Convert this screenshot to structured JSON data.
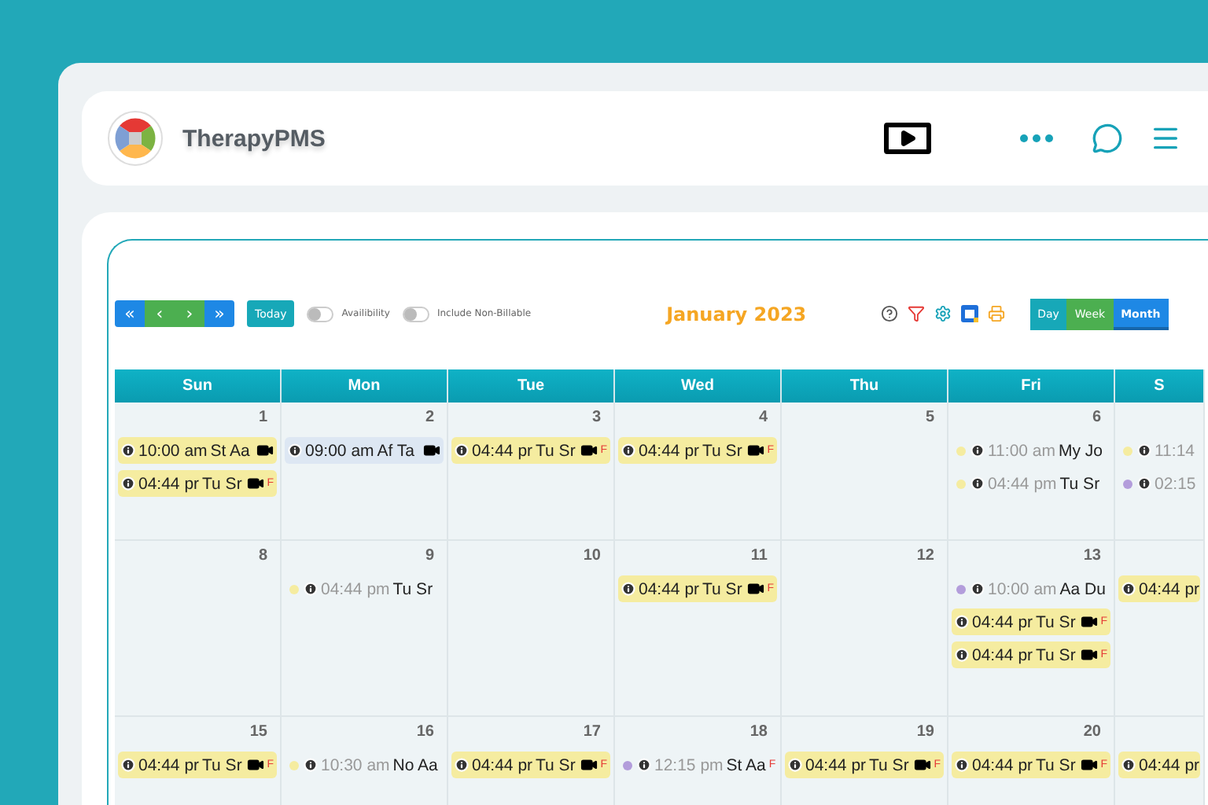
{
  "app": {
    "name": "TherapyPMS"
  },
  "toolbar": {
    "nav": [
      {
        "label": "«",
        "color": "#1e88e5"
      },
      {
        "label": "‹",
        "color": "#4caf50"
      },
      {
        "label": "›",
        "color": "#4caf50"
      },
      {
        "label": "»",
        "color": "#1e88e5"
      }
    ],
    "today": "Today",
    "toggles": [
      {
        "label": "Availibility",
        "on": false
      },
      {
        "label": "Include Non-Billable",
        "on": false
      }
    ],
    "title": "January 2023",
    "views": [
      {
        "label": "Day",
        "color": "#17a8b8",
        "selected": false
      },
      {
        "label": "Week",
        "color": "#4caf50",
        "selected": false
      },
      {
        "label": "Month",
        "color": "#1e88e5",
        "selected": true
      }
    ]
  },
  "calendar": {
    "days": [
      "Sun",
      "Mon",
      "Tue",
      "Wed",
      "Thu",
      "Fri",
      "S"
    ],
    "weeks": [
      [
        {
          "date": "1",
          "events": [
            {
              "kind": "block",
              "time": "10:00 am",
              "name": "St Aa",
              "color": "#f5eca0"
            },
            {
              "kind": "block",
              "time": "04:44 pr",
              "name": "Tu Sr",
              "color": "#f5eca0",
              "tag": "F"
            }
          ]
        },
        {
          "date": "2",
          "events": [
            {
              "kind": "block",
              "time": "09:00 am",
              "name": "Af Ta",
              "color": "#dde7f3"
            }
          ]
        },
        {
          "date": "3",
          "events": [
            {
              "kind": "block",
              "time": "04:44 pr",
              "name": "Tu Sr",
              "color": "#f5eca0",
              "tag": "F"
            }
          ]
        },
        {
          "date": "4",
          "events": [
            {
              "kind": "block",
              "time": "04:44 pr",
              "name": "Tu Sr",
              "color": "#f5eca0",
              "tag": "F"
            }
          ]
        },
        {
          "date": "5"
        },
        {
          "date": "6",
          "events": [
            {
              "kind": "dot",
              "time": "11:00 am",
              "name": "My Jo",
              "color": "#f5eca0"
            },
            {
              "kind": "dot",
              "time": "04:44 pm",
              "name": "Tu Sr",
              "color": "#f5eca0"
            }
          ]
        },
        {
          "events": [
            {
              "kind": "dot",
              "time": "11:14",
              "color": "#f5eca0"
            },
            {
              "kind": "dot",
              "time": "02:15",
              "color": "#b39ddb"
            }
          ]
        }
      ],
      [
        {
          "date": "8"
        },
        {
          "date": "9",
          "events": [
            {
              "kind": "dot",
              "time": "04:44 pm",
              "name": "Tu Sr",
              "color": "#f5eca0"
            }
          ]
        },
        {
          "date": "10"
        },
        {
          "date": "11",
          "events": [
            {
              "kind": "block",
              "time": "04:44 pr",
              "name": "Tu Sr",
              "color": "#f5eca0",
              "tag": "F"
            }
          ]
        },
        {
          "date": "12"
        },
        {
          "date": "13",
          "events": [
            {
              "kind": "dot",
              "time": "10:00 am",
              "name": "Aa Du",
              "color": "#b39ddb"
            },
            {
              "kind": "block",
              "time": "04:44 pr",
              "name": "Tu Sr",
              "color": "#f5eca0",
              "tag": "F"
            },
            {
              "kind": "block",
              "time": "04:44 pr",
              "name": "Tu Sr",
              "color": "#f5eca0",
              "tag": "F"
            }
          ]
        },
        {
          "events": [
            {
              "kind": "block",
              "time": "04:44 pr",
              "color": "#f5eca0"
            }
          ]
        }
      ],
      [
        {
          "date": "15",
          "events": [
            {
              "kind": "block",
              "time": "04:44 pr",
              "name": "Tu Sr",
              "color": "#f5eca0",
              "tag": "F"
            }
          ]
        },
        {
          "date": "16",
          "events": [
            {
              "kind": "dot",
              "time": "10:30 am",
              "name": "No Aa",
              "color": "#f5eca0"
            }
          ]
        },
        {
          "date": "17",
          "events": [
            {
              "kind": "block",
              "time": "04:44 pr",
              "name": "Tu Sr",
              "color": "#f5eca0",
              "tag": "F"
            }
          ]
        },
        {
          "date": "18",
          "events": [
            {
              "kind": "dot",
              "time": "12:15 pm",
              "name": "St Aa",
              "color": "#b39ddb",
              "tag": "F"
            }
          ]
        },
        {
          "date": "19",
          "events": [
            {
              "kind": "block",
              "time": "04:44 pr",
              "name": "Tu Sr",
              "color": "#f5eca0",
              "tag": "F"
            }
          ]
        },
        {
          "date": "20",
          "events": [
            {
              "kind": "block",
              "time": "04:44 pr",
              "name": "Tu Sr",
              "color": "#f5eca0",
              "tag": "F"
            }
          ]
        },
        {
          "events": [
            {
              "kind": "block",
              "time": "04:44 pr",
              "color": "#f5eca0"
            }
          ]
        }
      ]
    ]
  }
}
